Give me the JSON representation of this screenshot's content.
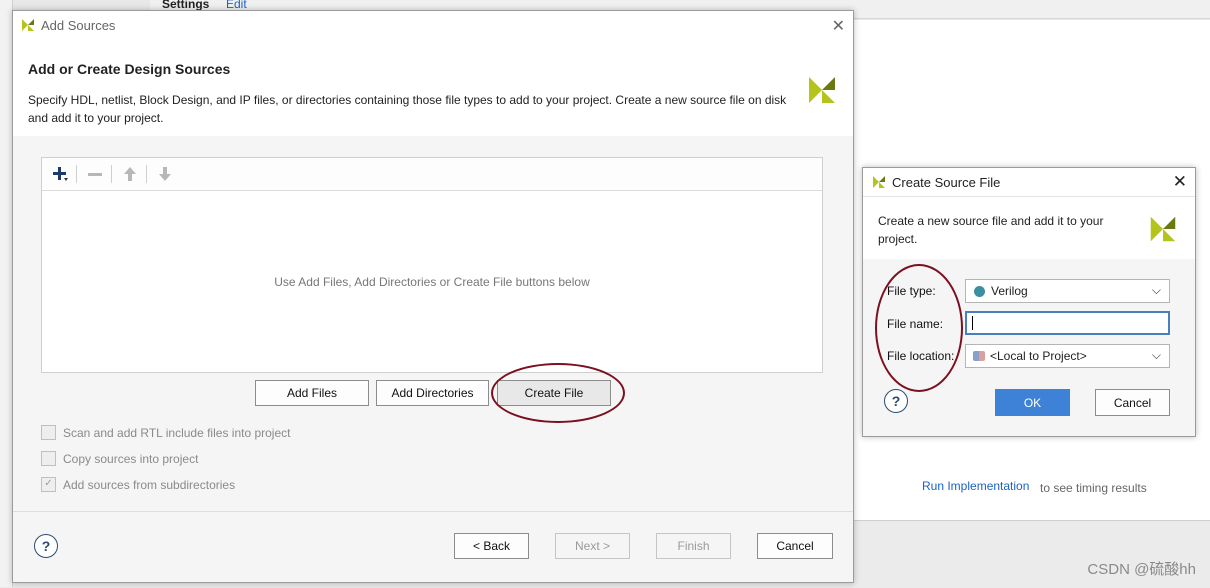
{
  "background": {
    "settings_label": "Settings",
    "edit_link": "Edit",
    "run_link": "Run Implementation",
    "run_suffix": "to see timing results",
    "watermark": "CSDN @硫酸hh"
  },
  "add_sources": {
    "title": "Add Sources",
    "heading": "Add or Create Design Sources",
    "description": "Specify HDL, netlist, Block Design, and IP files, or directories containing those file types to add to your project. Create a new source file on disk and add it to your project.",
    "empty_message": "Use Add Files, Add Directories or Create File buttons below",
    "buttons": {
      "add_files": "Add Files",
      "add_directories": "Add Directories",
      "create_file": "Create File",
      "back": "< Back",
      "next": "Next >",
      "finish": "Finish",
      "cancel": "Cancel"
    },
    "options": [
      {
        "label": "Scan and add RTL include files into project",
        "checked": false
      },
      {
        "label": "Copy sources into project",
        "checked": false
      },
      {
        "label": "Add sources from subdirectories",
        "checked": true
      }
    ],
    "toolbar_icons": [
      "add-icon",
      "remove-icon",
      "move-up-icon",
      "move-down-icon"
    ]
  },
  "create_source": {
    "title": "Create Source File",
    "description": "Create a new source file and add it to your project.",
    "fields": {
      "file_type_label": "File type:",
      "file_type_value": "Verilog",
      "file_name_label": "File name:",
      "file_name_value": "",
      "file_location_label": "File location:",
      "file_location_value": "<Local to Project>"
    },
    "buttons": {
      "ok": "OK",
      "cancel": "Cancel"
    }
  },
  "colors": {
    "accent": "#3d82d6",
    "annotation_ring": "#7a1020",
    "logo": "#b5c41c"
  }
}
